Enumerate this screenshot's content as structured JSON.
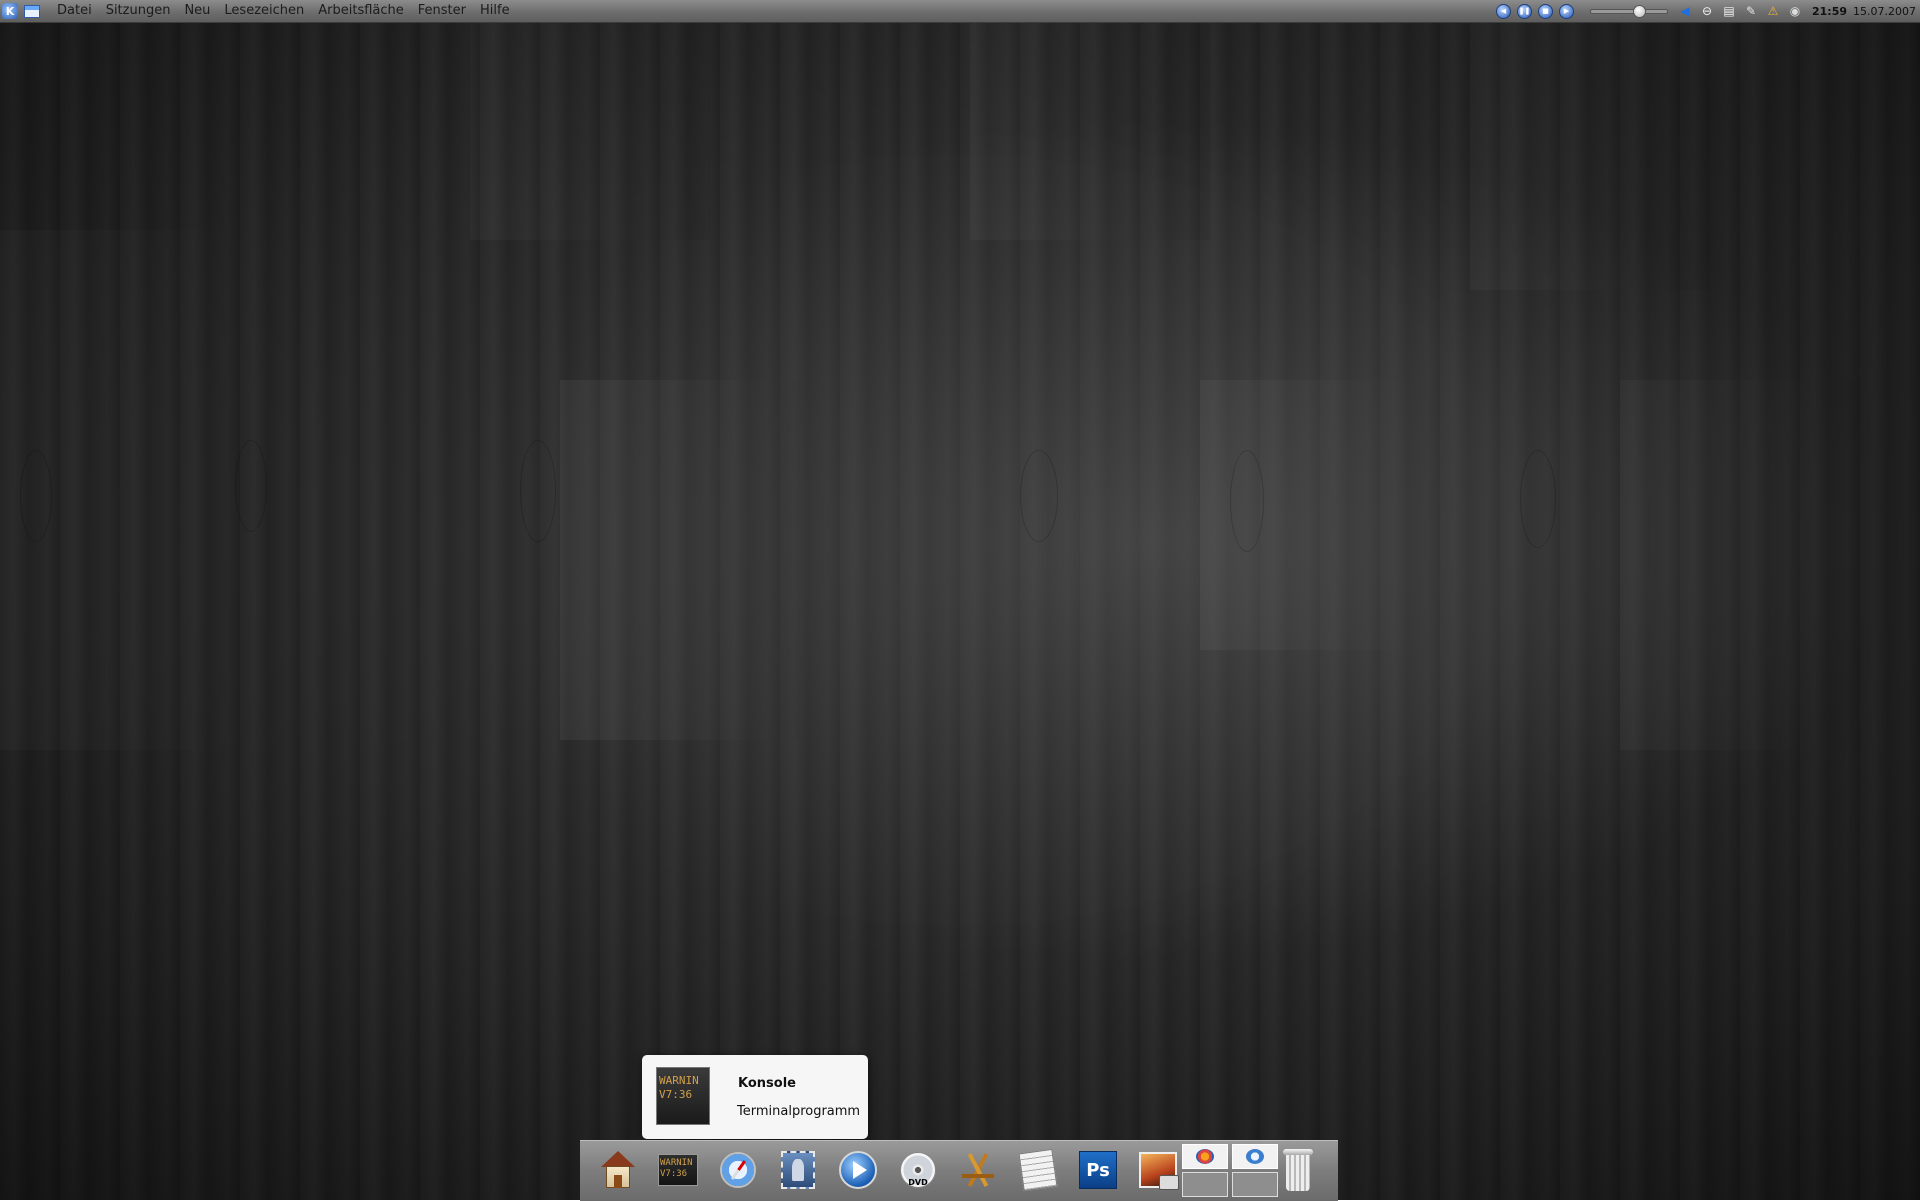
{
  "top_panel": {
    "menu": [
      "Datei",
      "Sitzungen",
      "Neu",
      "Lesezeichen",
      "Arbeitsfläche",
      "Fenster",
      "Hilfe"
    ],
    "clock_time": "21:59",
    "clock_date": "15.07.2007",
    "volume_level": 0.62,
    "icons": {
      "kde_menu": "kde-menu-icon",
      "window_list": "window-list-icon",
      "media": [
        "previous-icon",
        "pause-icon",
        "stop-icon",
        "next-icon"
      ],
      "tray": [
        "speaker-icon",
        "disk-icon",
        "clipboard-icon",
        "network-icon",
        "weather-icon",
        "update-icon"
      ]
    }
  },
  "tooltip": {
    "title": "Konsole",
    "description": "Terminalprogramm",
    "icon_text": "WARNIN\nV7:36"
  },
  "dock": {
    "items": [
      "home-icon",
      "konsole-icon",
      "safari-icon",
      "mail-icon",
      "media-player-icon",
      "dvd-player-icon",
      "app-store-icon",
      "text-editor-icon",
      "photoshop-icon",
      "photo-icon",
      "desktop-pager",
      "trash-icon"
    ],
    "konsole_text": "WARNIN\nV7:36",
    "photoshop_label": "Ps",
    "dvd_label": "DVD",
    "active_desktop": 1
  }
}
